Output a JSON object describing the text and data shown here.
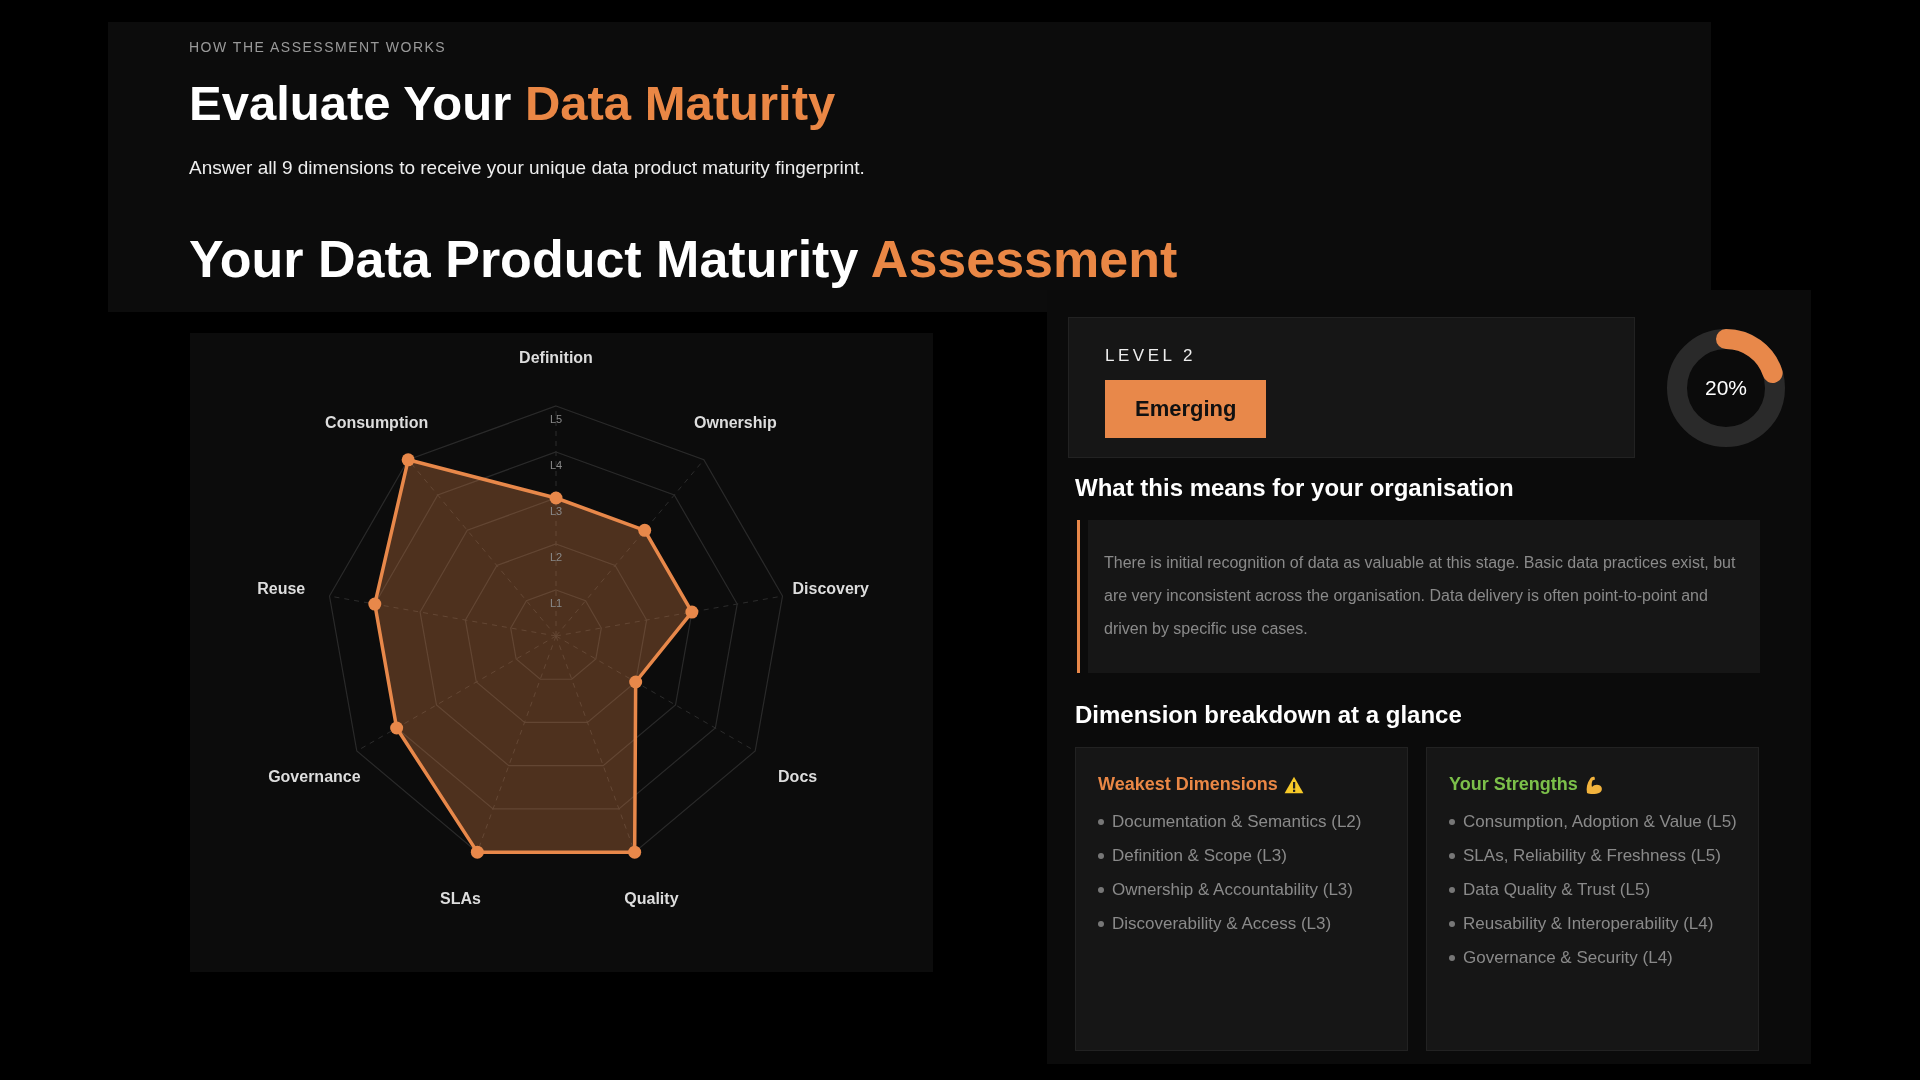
{
  "header": {
    "eyebrow": "HOW THE ASSESSMENT WORKS",
    "title": [
      {
        "text": "Evaluate Your ",
        "accent": false
      },
      {
        "text": "Data Maturity",
        "accent": true
      }
    ],
    "subtitle": "Answer all 9 dimensions to receive your unique data product maturity fingerprint.",
    "section_title": [
      {
        "text": "Your Data Product Maturity ",
        "accent": false
      },
      {
        "text": "Assessment",
        "accent": true
      }
    ]
  },
  "radar": {
    "chart_data": {
      "type": "radar",
      "categories": [
        "Definition",
        "Ownership",
        "Discovery",
        "Docs",
        "Quality",
        "SLAs",
        "Governance",
        "Reuse",
        "Consumption"
      ],
      "yticks": [
        {
          "value": 1,
          "label": "L1"
        },
        {
          "value": 2,
          "label": "L2"
        },
        {
          "value": 3,
          "label": "L3"
        },
        {
          "value": 4,
          "label": "L4"
        },
        {
          "value": 5,
          "label": "L5"
        }
      ],
      "ylim": [
        0,
        5
      ],
      "series": [
        {
          "color": "#e8884a",
          "values": [
            3,
            3,
            3,
            2,
            5,
            5,
            4,
            4,
            5
          ]
        }
      ]
    }
  },
  "result": {
    "level_label": "LEVEL 2",
    "badge": "Emerging",
    "progress": {
      "level": 0.2,
      "reading": "20%"
    },
    "meaning_heading": "What this means for your organisation",
    "meaning_text": "There is initial recognition of data as valuable at this stage. Basic data practices exist, but are very inconsistent across the organisation. Data delivery is often point-to-point and driven by specific use cases.",
    "breakdown_heading": "Dimension breakdown at a glance",
    "cards": [
      {
        "kind": "weak",
        "title": "Weakest Dimensions",
        "items": [
          "Documentation & Semantics (L2)",
          "Definition & Scope (L3)",
          "Ownership & Accountability (L3)",
          "Discoverability & Access (L3)"
        ]
      },
      {
        "kind": "strength",
        "title": "Your Strengths",
        "items": [
          "Consumption, Adoption & Value (L5)",
          "SLAs, Reliability & Freshness (L5)",
          "Data Quality & Trust (L5)",
          "Reusability & Interoperability (L4)",
          "Governance & Security (L4)"
        ]
      }
    ]
  }
}
